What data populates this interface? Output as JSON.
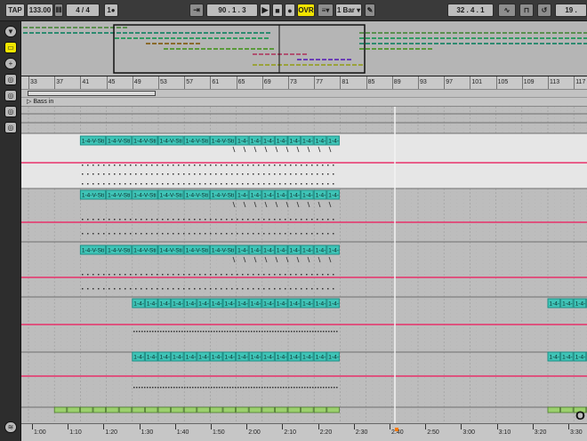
{
  "transport": {
    "tap": "TAP",
    "tempo": "133.00",
    "tempo_nudge": "⦀⦀",
    "signature": "4 / 4",
    "metronome": "1●",
    "follow": "⇥",
    "position": "90 . 1 . 3",
    "play": "▶",
    "stop": "■",
    "record": "●",
    "overdub": "OVR",
    "quantize_menu": "≡▾",
    "quantize": "1 Bar ▾",
    "draw": "✎",
    "loop_length": "32 . 4 . 1",
    "curve": "∿",
    "punch": "⊓",
    "loop_toggle": "↺",
    "cpu": "19 ."
  },
  "sidebar": {
    "top_icon": "▼",
    "items": [
      "▭",
      "+",
      "◎",
      "◎",
      "◎",
      "◎"
    ],
    "bottom_icon": "≋"
  },
  "ruler": {
    "bars": [
      "33",
      "37",
      "41",
      "45",
      "49",
      "53",
      "57",
      "61",
      "65",
      "69",
      "73",
      "77",
      "81",
      "85",
      "89",
      "93",
      "97",
      "101",
      "105",
      "109",
      "113",
      "117"
    ]
  },
  "locator": {
    "name": "Bass in"
  },
  "clips": {
    "label_long": "1-4-V-Sti",
    "label_short": "1-4-"
  },
  "time": {
    "labels": [
      "1:00",
      "1:10",
      "1:20",
      "1:30",
      "1:40",
      "1:50",
      "2:00",
      "2:10",
      "2:20",
      "2:30",
      "2:40",
      "2:50",
      "3:00",
      "3:10",
      "3:20",
      "3:30"
    ]
  },
  "overlay_text": "O",
  "colors": {
    "clip": "#3fc4b7",
    "clip_dark": "#1d8f86",
    "clip_green": "#9bd06d",
    "automation": "#e8306a",
    "accent": "#f1e600"
  }
}
